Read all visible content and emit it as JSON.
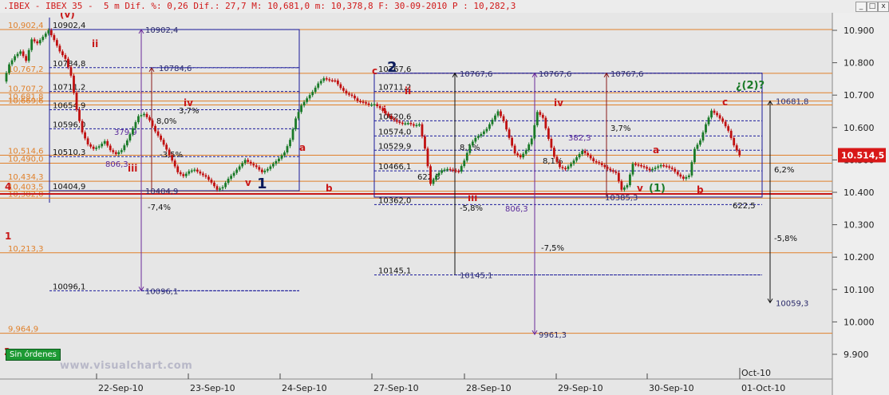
{
  "window": {
    "title": ".IBEX - IBEX 35 -  5 m Dif. %: 0,26 Dif.: 27,7 M: 10,681,0 m: 10,378,8 F: 30-09-2010 P : 10,282,3",
    "buttons": [
      "_",
      "□",
      "x"
    ]
  },
  "badge": "Sin órdenes",
  "watermark": "www.visualchart.com",
  "colors": {
    "background": "#e6e6e6",
    "candle_up": "#1a7a28",
    "candle_down": "#c01010",
    "orange_level": "#e0802a",
    "blue_dashed": "#1a1a9a",
    "purple_arrow": "#6a2a9a",
    "price_label_bg": "#d81818"
  },
  "chart_data": {
    "type": "candlestick",
    "ylim": [
      9860,
      10960
    ],
    "y_ticks": [
      "10.900",
      "10.800",
      "10.700",
      "10.600",
      "10.500",
      "10.400",
      "10.300",
      "10.200",
      "10.100",
      "10.000",
      "9.900"
    ],
    "x_labels": [
      "22-Sep-10",
      "23-Sep-10",
      "24-Sep-10",
      "27-Sep-10",
      "28-Sep-10",
      "29-Sep-10",
      "30-Sep-10",
      "01-Oct-10"
    ],
    "x_top_label": "Oct-10",
    "last_price_label": "10.514,5",
    "last_price": 10514.5,
    "orange_levels": [
      {
        "label": "10,902,4",
        "value": 10902.4
      },
      {
        "label": "10,767,2",
        "value": 10767.2
      },
      {
        "label": "10,707,2",
        "value": 10707.2
      },
      {
        "label": "10,681,8",
        "value": 10681.8
      },
      {
        "label": "10,669,6",
        "value": 10669.6
      },
      {
        "label": "10,514,6",
        "value": 10514.6
      },
      {
        "label": "10,490,0",
        "value": 10490.0
      },
      {
        "label": "10,434,3",
        "value": 10434.3
      },
      {
        "label": "10,403,5",
        "value": 10403.5
      },
      {
        "label": "10,382,0",
        "value": 10382.0
      },
      {
        "label": "10,213,3",
        "value": 10213.3
      },
      {
        "label": "9,964,9",
        "value": 9964.9
      }
    ],
    "left_fib_labels": [
      {
        "label": "10902,4",
        "value": 10902.4
      },
      {
        "label": "10784,8",
        "value": 10784.8
      },
      {
        "label": "10711,2",
        "value": 10711.2
      },
      {
        "label": "10654,9",
        "value": 10654.9
      },
      {
        "label": "10596,0",
        "value": 10596.0
      },
      {
        "label": "10510,3",
        "value": 10510.3
      },
      {
        "label": "10404,9",
        "value": 10404.9
      },
      {
        "label": "10096,1",
        "value": 10096.1
      }
    ],
    "mid_fib_labels": [
      {
        "label": "10767,6",
        "value": 10767.6
      },
      {
        "label": "10711,2",
        "value": 10711.2
      },
      {
        "label": "10620,6",
        "value": 10620.6
      },
      {
        "label": "10574,0",
        "value": 10574.0
      },
      {
        "label": "10529,9",
        "value": 10529.9
      },
      {
        "label": "10466,1",
        "value": 10466.1
      },
      {
        "label": "10362,0",
        "value": 10362.0
      },
      {
        "label": "10145,1",
        "value": 10145.1
      }
    ],
    "arrow_targets": [
      {
        "label": "10902,4",
        "value": 10902.4
      },
      {
        "label": "10784,6",
        "value": 10784.6
      },
      {
        "label": "10404,9",
        "value": 10404.9
      },
      {
        "label": "10096,1",
        "value": 10096.1
      },
      {
        "label": "10767,6",
        "value": 10767.6
      },
      {
        "label": "10767,6",
        "value": 10767.6
      },
      {
        "label": "10767,6",
        "value": 10767.6
      },
      {
        "label": "10145,1",
        "value": 10145.1
      },
      {
        "label": "9961,3",
        "value": 9961.3
      },
      {
        "label": "10385,3",
        "value": 10385.3
      },
      {
        "label": "10681,8",
        "value": 10681.8
      },
      {
        "label": "10059,3",
        "value": 10059.3
      }
    ],
    "percent_labels": [
      "3,7%",
      "8,0%",
      "-3,5%",
      "-7,4%",
      "8,1%",
      "-5,8%",
      "3,7%",
      "8,1%",
      "-7,5%",
      "6,2%",
      "-5,8%"
    ],
    "extension_labels": [
      "379,9",
      "806,3",
      "622,5",
      "382,3",
      "806,3",
      "622,5"
    ],
    "wave_labels": {
      "red": [
        "(v)",
        "ii",
        "iii",
        "iv",
        "v",
        "a",
        "b",
        "c",
        "i",
        "ii",
        "iii",
        "iv",
        "a",
        "b",
        "c"
      ],
      "navy": [
        "1",
        "2"
      ],
      "green": [
        "(1)",
        "¿(2)?"
      ],
      "left_margin": [
        "4",
        "1",
        "2"
      ]
    },
    "price_path": [
      [
        0,
        10742
      ],
      [
        2,
        10795
      ],
      [
        4,
        10820
      ],
      [
        6,
        10835
      ],
      [
        8,
        10806
      ],
      [
        10,
        10872
      ],
      [
        12,
        10860
      ],
      [
        14,
        10880
      ],
      [
        16,
        10900
      ],
      [
        18,
        10870
      ],
      [
        20,
        10835
      ],
      [
        22,
        10812
      ],
      [
        24,
        10760
      ],
      [
        26,
        10655
      ],
      [
        28,
        10585
      ],
      [
        30,
        10548
      ],
      [
        32,
        10534
      ],
      [
        34,
        10542
      ],
      [
        36,
        10558
      ],
      [
        38,
        10530
      ],
      [
        40,
        10518
      ],
      [
        42,
        10530
      ],
      [
        44,
        10560
      ],
      [
        46,
        10598
      ],
      [
        48,
        10635
      ],
      [
        50,
        10642
      ],
      [
        52,
        10622
      ],
      [
        54,
        10588
      ],
      [
        56,
        10562
      ],
      [
        58,
        10532
      ],
      [
        60,
        10498
      ],
      [
        62,
        10462
      ],
      [
        64,
        10450
      ],
      [
        66,
        10465
      ],
      [
        68,
        10470
      ],
      [
        70,
        10458
      ],
      [
        72,
        10448
      ],
      [
        74,
        10430
      ],
      [
        76,
        10408
      ],
      [
        78,
        10416
      ],
      [
        80,
        10442
      ],
      [
        82,
        10460
      ],
      [
        84,
        10480
      ],
      [
        86,
        10500
      ],
      [
        88,
        10488
      ],
      [
        90,
        10478
      ],
      [
        92,
        10462
      ],
      [
        94,
        10472
      ],
      [
        96,
        10488
      ],
      [
        98,
        10504
      ],
      [
        100,
        10523
      ],
      [
        102,
        10562
      ],
      [
        104,
        10628
      ],
      [
        106,
        10668
      ],
      [
        108,
        10690
      ],
      [
        110,
        10710
      ],
      [
        112,
        10736
      ],
      [
        114,
        10752
      ],
      [
        116,
        10746
      ],
      [
        118,
        10745
      ],
      [
        120,
        10722
      ],
      [
        122,
        10705
      ],
      [
        124,
        10698
      ],
      [
        126,
        10682
      ],
      [
        128,
        10678
      ],
      [
        130,
        10670
      ],
      [
        132,
        10672
      ],
      [
        134,
        10660
      ],
      [
        136,
        10643
      ],
      [
        138,
        10628
      ],
      [
        140,
        10618
      ],
      [
        142,
        10612
      ],
      [
        144,
        10614
      ],
      [
        146,
        10606
      ],
      [
        148,
        10610
      ],
      [
        150,
        10535
      ],
      [
        152,
        10426
      ],
      [
        154,
        10452
      ],
      [
        156,
        10468
      ],
      [
        158,
        10472
      ],
      [
        160,
        10468
      ],
      [
        162,
        10464
      ],
      [
        164,
        10498
      ],
      [
        166,
        10545
      ],
      [
        168,
        10568
      ],
      [
        170,
        10580
      ],
      [
        172,
        10596
      ],
      [
        174,
        10624
      ],
      [
        176,
        10650
      ],
      [
        178,
        10620
      ],
      [
        180,
        10568
      ],
      [
        182,
        10520
      ],
      [
        184,
        10508
      ],
      [
        186,
        10530
      ],
      [
        188,
        10566
      ],
      [
        190,
        10648
      ],
      [
        192,
        10630
      ],
      [
        194,
        10565
      ],
      [
        196,
        10510
      ],
      [
        198,
        10478
      ],
      [
        200,
        10472
      ],
      [
        202,
        10488
      ],
      [
        204,
        10508
      ],
      [
        206,
        10528
      ],
      [
        208,
        10514
      ],
      [
        210,
        10496
      ],
      [
        212,
        10490
      ],
      [
        214,
        10478
      ],
      [
        216,
        10468
      ],
      [
        218,
        10460
      ],
      [
        220,
        10408
      ],
      [
        222,
        10422
      ],
      [
        224,
        10488
      ],
      [
        226,
        10484
      ],
      [
        228,
        10478
      ],
      [
        230,
        10468
      ],
      [
        232,
        10476
      ],
      [
        234,
        10484
      ],
      [
        236,
        10480
      ],
      [
        238,
        10472
      ],
      [
        240,
        10455
      ],
      [
        242,
        10442
      ],
      [
        244,
        10452
      ],
      [
        246,
        10534
      ],
      [
        248,
        10560
      ],
      [
        250,
        10610
      ],
      [
        252,
        10652
      ],
      [
        254,
        10638
      ],
      [
        256,
        10618
      ],
      [
        258,
        10590
      ],
      [
        260,
        10545
      ],
      [
        262,
        10514
      ]
    ]
  }
}
